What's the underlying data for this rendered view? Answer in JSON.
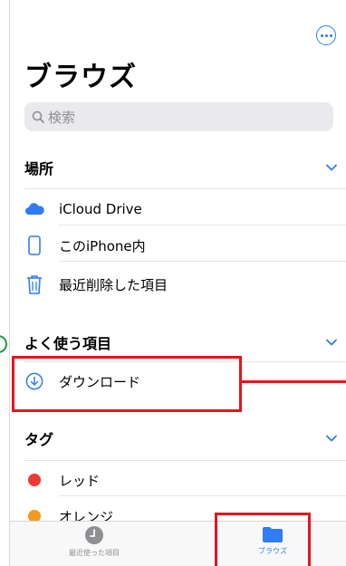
{
  "header": {
    "title": "ブラウズ",
    "more_icon": "ellipsis-circle-icon"
  },
  "search": {
    "placeholder": "検索"
  },
  "sections": {
    "locations": {
      "title": "場所",
      "items": [
        {
          "label": "iCloud Drive",
          "icon": "icloud-icon"
        },
        {
          "label": "このiPhone内",
          "icon": "iphone-icon"
        },
        {
          "label": "最近削除した項目",
          "icon": "trash-icon"
        }
      ]
    },
    "favorites": {
      "title": "よく使う項目",
      "items": [
        {
          "label": "ダウンロード",
          "icon": "download-circle-icon"
        }
      ]
    },
    "tags": {
      "title": "タグ",
      "items": [
        {
          "label": "レッド",
          "color": "#eb3b30"
        },
        {
          "label": "オレンジ",
          "color": "#f39a1e"
        }
      ]
    }
  },
  "tabbar": {
    "recents": {
      "label": "最近使った項目",
      "icon": "clock-icon"
    },
    "browse": {
      "label": "ブラウズ",
      "icon": "folder-icon"
    }
  },
  "colors": {
    "accent": "#2f7cf6",
    "annotation": "#e8141b",
    "annotation_side": "#1d9e4a"
  }
}
